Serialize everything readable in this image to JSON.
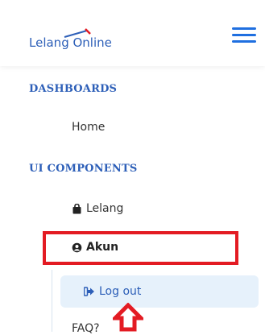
{
  "brand": {
    "name": "Lelang Online"
  },
  "sections": [
    {
      "label": "DASHBOARDS",
      "items": [
        {
          "label": "Home"
        }
      ]
    },
    {
      "label": "UI COMPONENTS",
      "items": [
        {
          "label": "Lelang",
          "icon": "shopping-bag-icon"
        },
        {
          "label": "Akun",
          "icon": "user-circle-icon"
        },
        {
          "label": "Log out",
          "icon": "sign-out-icon"
        },
        {
          "label": "FAQ?"
        }
      ]
    }
  ],
  "colors": {
    "accent": "#2d5fb8",
    "highlight_box": "#e31b23",
    "active_bg": "#e6f1fb"
  }
}
